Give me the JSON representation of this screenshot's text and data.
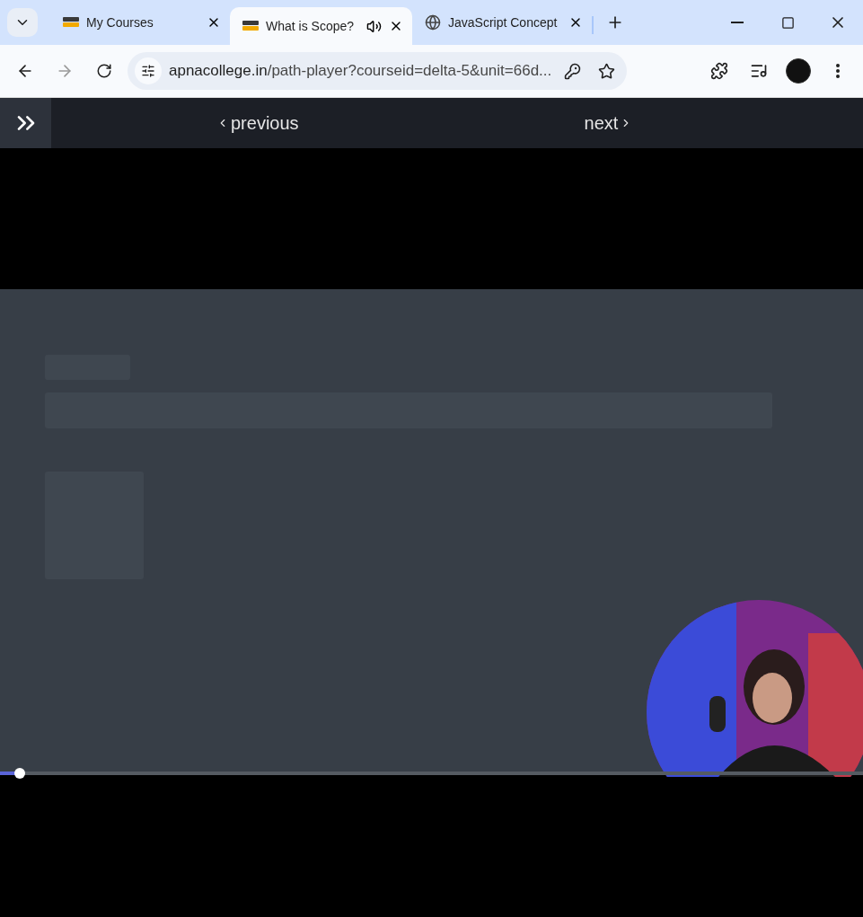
{
  "tabs": [
    {
      "title": "My Courses",
      "generic_icon": false,
      "audio": false,
      "selected": false
    },
    {
      "title": "What is Scope?",
      "generic_icon": false,
      "audio": true,
      "selected": true
    },
    {
      "title": "JavaScript Concept",
      "generic_icon": true,
      "audio": false,
      "selected": false
    }
  ],
  "address_bar": {
    "host": "apnacollege.in",
    "path": "/path-player?courseid=delta-5&unit=66d..."
  },
  "player_nav": {
    "previous": "previous",
    "next": "next"
  },
  "video": {
    "kind": "picture",
    "progress": {
      "level": 0.023
    }
  }
}
